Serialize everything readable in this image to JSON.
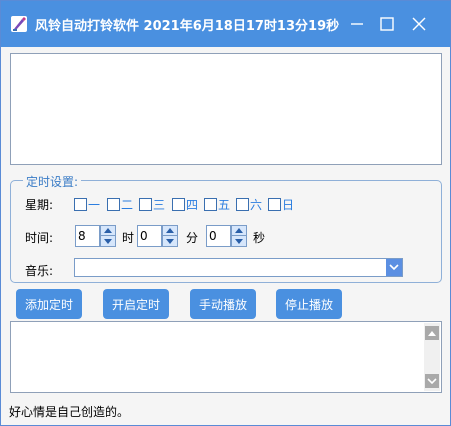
{
  "window": {
    "title": "风铃自动打铃软件   2021年6月18日17时13分19秒",
    "accent": "#4a90e0"
  },
  "timer_group": {
    "legend": "定时设置:",
    "weekday_label": "星期:",
    "weekdays": [
      {
        "label": "一",
        "checked": false
      },
      {
        "label": "二",
        "checked": false
      },
      {
        "label": "三",
        "checked": false
      },
      {
        "label": "四",
        "checked": false
      },
      {
        "label": "五",
        "checked": false
      },
      {
        "label": "六",
        "checked": false
      },
      {
        "label": "日",
        "checked": false
      }
    ],
    "time_label": "时间:",
    "hour_value": "8",
    "hour_unit": "时",
    "minute_value": "0",
    "minute_unit": "分",
    "second_value": "0",
    "second_unit": "秒",
    "music_label": "音乐:",
    "music_value": ""
  },
  "buttons": {
    "add_timer": "添加定时",
    "start_timer": "开启定时",
    "manual_play": "手动播放",
    "stop_play": "停止播放"
  },
  "status": {
    "text": "好心情是自己创造的。"
  },
  "icons": {
    "app": "bell-app-icon",
    "minimize": "minimize-icon",
    "maximize": "maximize-icon",
    "close": "close-icon",
    "combo": "chevron-down-icon"
  }
}
